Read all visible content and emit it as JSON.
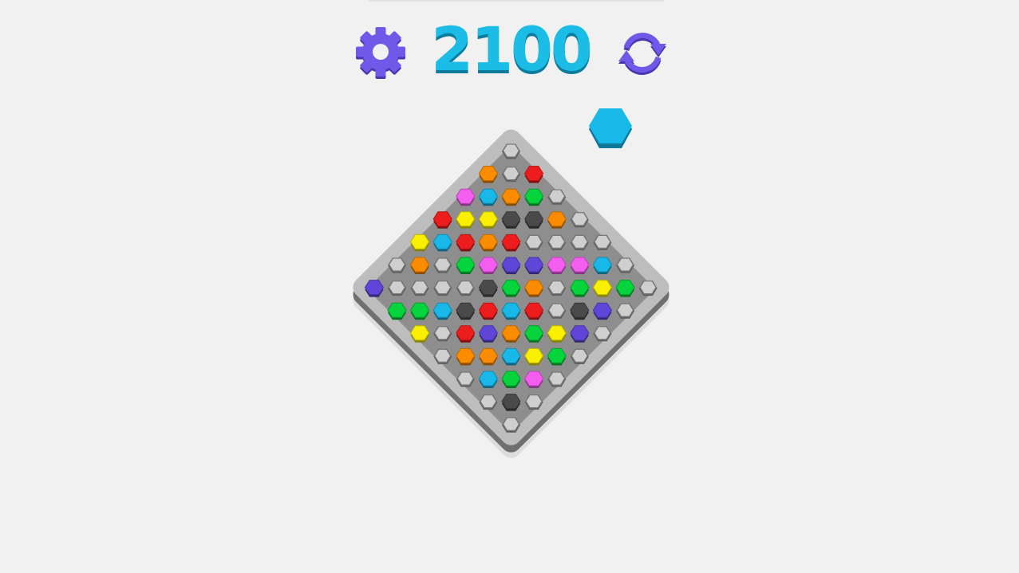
{
  "hud": {
    "score": "2100",
    "settings_icon": "gear-icon",
    "restart_icon": "refresh-icon"
  },
  "next_piece": {
    "color": "cyan"
  },
  "palette": {
    "empty": "#cfcfcf",
    "orange": "#fb8c00",
    "red": "#ee1d1d",
    "pink": "#f45ef0",
    "cyan": "#18b8e8",
    "green": "#05d43c",
    "yellow": "#f9f000",
    "black": "#4a4a4a",
    "purple": "#6046d8"
  },
  "board": {
    "rows": [
      [
        "empty"
      ],
      [
        "orange",
        "empty",
        "red"
      ],
      [
        "pink",
        "cyan",
        "orange",
        "green",
        "empty"
      ],
      [
        "red",
        "yellow",
        "yellow",
        "black",
        "black",
        "orange",
        "empty"
      ],
      [
        "yellow",
        "cyan",
        "red",
        "orange",
        "red",
        "empty",
        "empty",
        "empty",
        "empty"
      ],
      [
        "empty",
        "orange",
        "empty",
        "green",
        "pink",
        "purple",
        "purple",
        "pink",
        "pink",
        "cyan",
        "empty"
      ],
      [
        "purple",
        "empty",
        "empty",
        "empty",
        "empty",
        "black",
        "green",
        "orange",
        "empty",
        "green",
        "yellow",
        "green",
        "empty"
      ],
      [
        "green",
        "green",
        "cyan",
        "black",
        "red",
        "cyan",
        "red",
        "empty",
        "black",
        "purple",
        "empty"
      ],
      [
        "yellow",
        "empty",
        "red",
        "purple",
        "orange",
        "green",
        "yellow",
        "purple",
        "empty"
      ],
      [
        "empty",
        "orange",
        "orange",
        "cyan",
        "yellow",
        "green",
        "empty"
      ],
      [
        "empty",
        "cyan",
        "green",
        "pink",
        "empty"
      ],
      [
        "empty",
        "black",
        "empty"
      ],
      [
        "empty"
      ]
    ]
  }
}
